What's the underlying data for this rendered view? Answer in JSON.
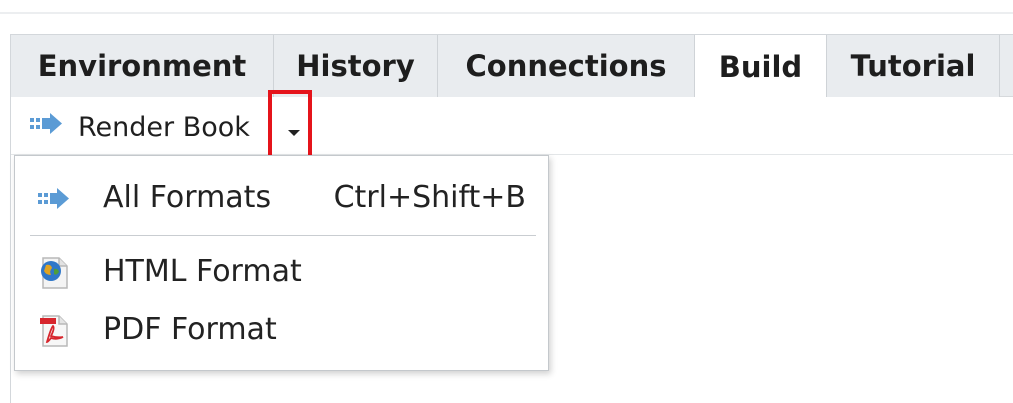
{
  "tabs": [
    {
      "label": "Environment",
      "active": false
    },
    {
      "label": "History",
      "active": false
    },
    {
      "label": "Connections",
      "active": false
    },
    {
      "label": "Build",
      "active": true
    },
    {
      "label": "Tutorial",
      "active": false
    }
  ],
  "toolbar": {
    "render_label": "Render Book",
    "render_icon": "build-arrow-icon",
    "highlight_color": "#e5141b"
  },
  "menu": {
    "all_formats": {
      "label": "All Formats",
      "shortcut": "Ctrl+Shift+B",
      "icon": "build-arrow-icon"
    },
    "html_format": {
      "label": "HTML Format",
      "icon": "html-globe-icon"
    },
    "pdf_format": {
      "label": "PDF Format",
      "icon": "pdf-icon"
    }
  },
  "colors": {
    "arrow": "#5b9bd5",
    "tab_bg": "#e9ecef",
    "active_tab_bg": "#ffffff"
  }
}
